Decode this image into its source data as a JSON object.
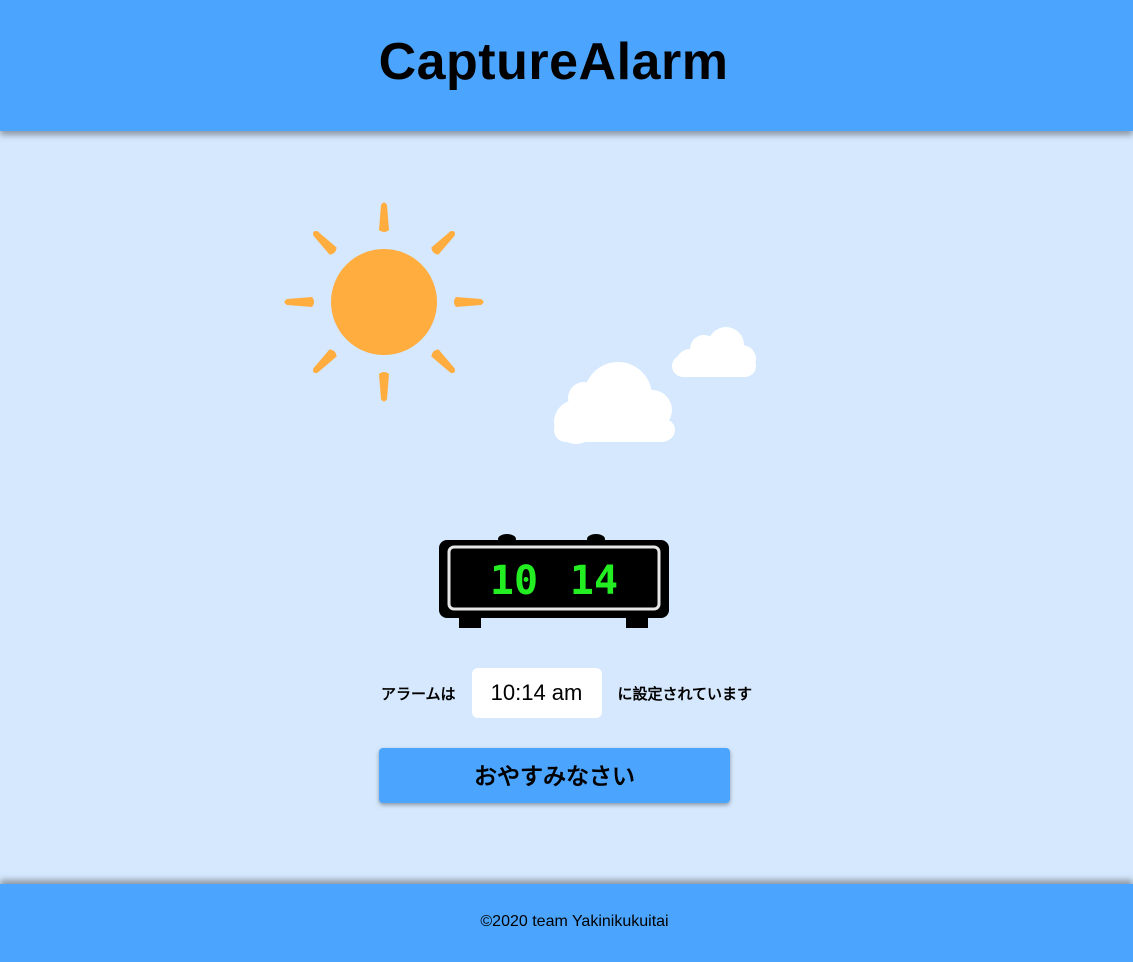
{
  "app": {
    "title": "CaptureAlarm"
  },
  "colors": {
    "header_bg": "#4ba5ff",
    "page_bg": "#d5e8fd",
    "sun": "#ffad3f",
    "cloud": "#ffffff",
    "clock_digits": "#22ee22"
  },
  "clock": {
    "hour": "10",
    "minute": "14"
  },
  "alarm": {
    "prefix": "アラームは",
    "time": "10:14 am",
    "suffix": "に設定されています"
  },
  "sleep_button": {
    "label": "おやすみなさい"
  },
  "footer": {
    "copyright": "©2020 team Yakinikukuitai"
  },
  "icons": [
    "sun-icon",
    "cloud-icon",
    "digital-clock-icon"
  ]
}
